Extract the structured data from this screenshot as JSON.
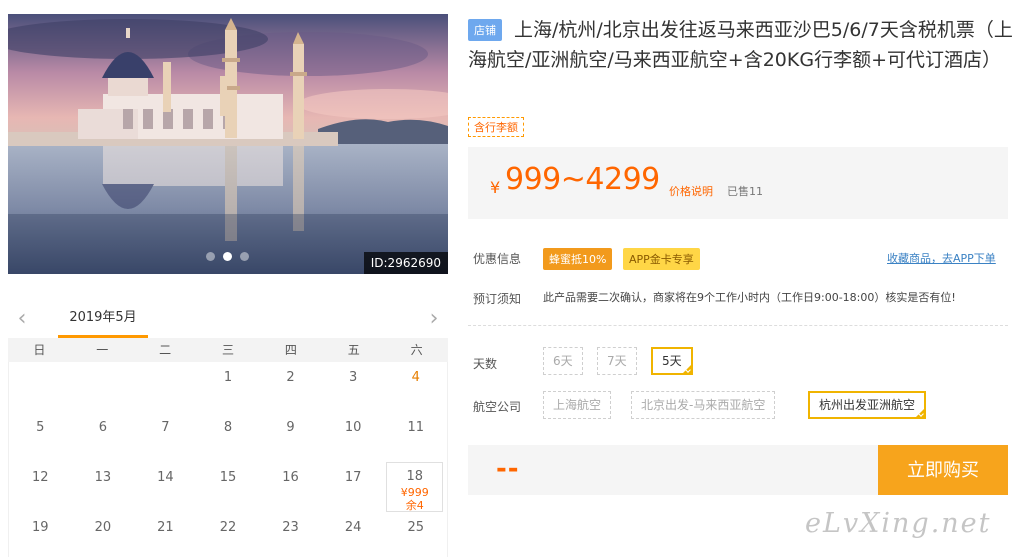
{
  "photo": {
    "id_label": "ID:2962690",
    "slide_count": 3,
    "active_slide": 2
  },
  "calendar": {
    "month": "2019年5月",
    "prev_icon": "chevron-left-icon",
    "next_icon": "chevron-right-icon",
    "weekdays": [
      "日",
      "一",
      "二",
      "三",
      "四",
      "五",
      "六"
    ],
    "rows": [
      [
        "",
        "",
        "",
        "1",
        "2",
        "3",
        "4"
      ],
      [
        "5",
        "6",
        "7",
        "8",
        "9",
        "10",
        "11"
      ],
      [
        "12",
        "13",
        "14",
        "15",
        "16",
        "17",
        "18"
      ],
      [
        "19",
        "20",
        "21",
        "22",
        "23",
        "24",
        "25"
      ]
    ],
    "available": {
      "day": "18",
      "price": "¥999",
      "remaining": "余4"
    }
  },
  "product": {
    "store_badge": "店铺",
    "title": "上海/杭州/北京出发往返马来西亚沙巴5/6/7天含税机票（上海航空/亚洲航空/马来西亚航空+含20KG行李额+可代订酒店）",
    "tag": "含行李额",
    "currency": "¥",
    "price_range": "999~4299",
    "price_note": "价格说明",
    "sold": "已售11"
  },
  "promo": {
    "label": "优惠信息",
    "badge_honey": "蜂蜜抵10%",
    "badge_app": "APP金卡专享",
    "fav_link": "收藏商品，去APP下单"
  },
  "booking": {
    "label": "预订须知",
    "notice": "此产品需要二次确认，商家将在9个工作小时内（工作日9:00-18:00）核实是否有位!"
  },
  "days": {
    "label": "天数",
    "options": [
      "6天",
      "7天",
      "5天"
    ],
    "selected": "5天"
  },
  "airline": {
    "label": "航空公司",
    "options": [
      "上海航空",
      "北京出发-马来西亚航空",
      "杭州出发亚洲航空"
    ],
    "selected": "杭州出发亚洲航空"
  },
  "buy": {
    "price_placeholder": "--",
    "button": "立即购买"
  },
  "colors": {
    "accent": "#f60",
    "button": "#f7a41c",
    "store_badge": "#6ea8ee",
    "selected_border": "#f0b400"
  },
  "watermark": "eLvXing.net"
}
